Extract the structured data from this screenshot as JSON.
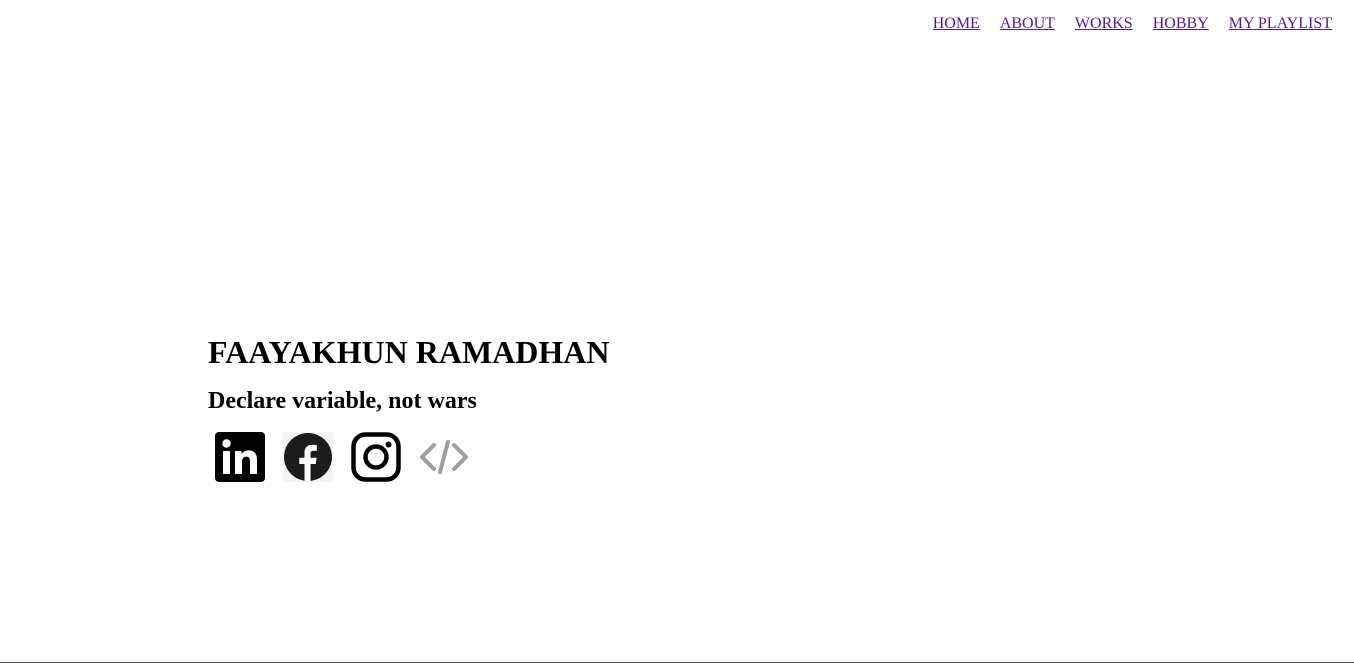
{
  "nav": {
    "items": [
      {
        "label": "HOME"
      },
      {
        "label": "ABOUT"
      },
      {
        "label": "WORKS"
      },
      {
        "label": "HOBBY"
      },
      {
        "label": "MY PLAYLIST"
      }
    ]
  },
  "hero": {
    "name": "FAAYAKHUN RAMADHAN",
    "tagline": "Declare variable, not wars"
  },
  "socials": [
    {
      "icon": "linkedin-icon"
    },
    {
      "icon": "facebook-icon"
    },
    {
      "icon": "instagram-icon"
    },
    {
      "icon": "code-icon"
    }
  ],
  "colors": {
    "link": "#551a8b",
    "text": "#000000",
    "code_icon": "#9e9e9e"
  }
}
